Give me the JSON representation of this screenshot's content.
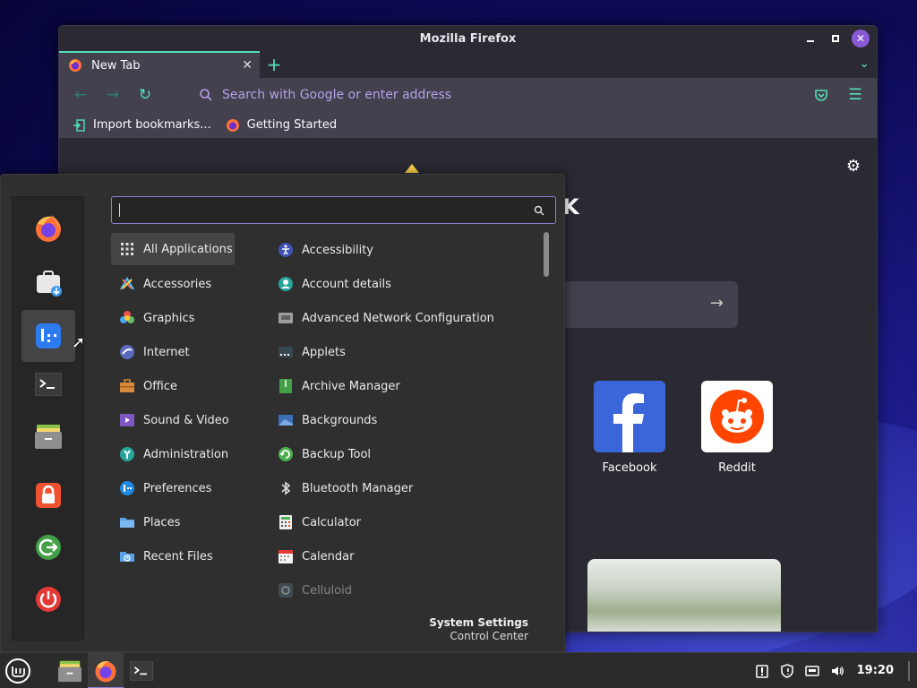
{
  "colors": {
    "accent_teal": "#53e0b8",
    "accent_purple": "#8f7fd6",
    "menu_bg": "#2f2f2f",
    "firefox_bg": "#2b2a33"
  },
  "firefox": {
    "title": "Mozilla Firefox",
    "tab_label": "New Tab",
    "urlbar_placeholder": "Search with Google or enter address",
    "bookmarks": [
      {
        "label": "Import bookmarks...",
        "icon": "import-icon"
      },
      {
        "label": "Getting Started",
        "icon": "firefox-icon"
      }
    ],
    "top_sites": [
      {
        "label": "Facebook",
        "icon": "facebook-icon"
      },
      {
        "label": "Reddit",
        "icon": "reddit-icon"
      }
    ]
  },
  "menu": {
    "favorites": [
      {
        "name": "firefox",
        "icon": "firefox-icon"
      },
      {
        "name": "software-manager",
        "icon": "software-manager-icon"
      },
      {
        "name": "control-center",
        "icon": "control-center-icon"
      },
      {
        "name": "terminal",
        "icon": "terminal-icon"
      },
      {
        "name": "files",
        "icon": "files-icon"
      },
      {
        "name": "lock-screen",
        "icon": "lock-icon"
      },
      {
        "name": "logout",
        "icon": "logout-icon"
      },
      {
        "name": "shutdown",
        "icon": "power-icon"
      }
    ],
    "categories": [
      {
        "label": "All Applications",
        "icon": "grid-icon"
      },
      {
        "label": "Accessories",
        "icon": "accessories-icon"
      },
      {
        "label": "Graphics",
        "icon": "graphics-icon"
      },
      {
        "label": "Internet",
        "icon": "internet-icon"
      },
      {
        "label": "Office",
        "icon": "office-icon"
      },
      {
        "label": "Sound & Video",
        "icon": "sound-video-icon"
      },
      {
        "label": "Administration",
        "icon": "administration-icon"
      },
      {
        "label": "Preferences",
        "icon": "preferences-icon"
      },
      {
        "label": "Places",
        "icon": "places-icon"
      },
      {
        "label": "Recent Files",
        "icon": "recent-files-icon"
      }
    ],
    "applications": [
      {
        "label": "Accessibility",
        "icon": "accessibility-icon"
      },
      {
        "label": "Account details",
        "icon": "account-icon"
      },
      {
        "label": "Advanced Network Configuration",
        "icon": "network-icon"
      },
      {
        "label": "Applets",
        "icon": "applets-icon"
      },
      {
        "label": "Archive Manager",
        "icon": "archive-icon"
      },
      {
        "label": "Backgrounds",
        "icon": "backgrounds-icon"
      },
      {
        "label": "Backup Tool",
        "icon": "backup-icon"
      },
      {
        "label": "Bluetooth Manager",
        "icon": "bluetooth-icon"
      },
      {
        "label": "Calculator",
        "icon": "calculator-icon"
      },
      {
        "label": "Calendar",
        "icon": "calendar-icon"
      },
      {
        "label": "Celluloid",
        "icon": "celluloid-icon"
      }
    ],
    "footer_title": "System Settings",
    "footer_subtitle": "Control Center"
  },
  "taskbar": {
    "clock": "19:20"
  }
}
